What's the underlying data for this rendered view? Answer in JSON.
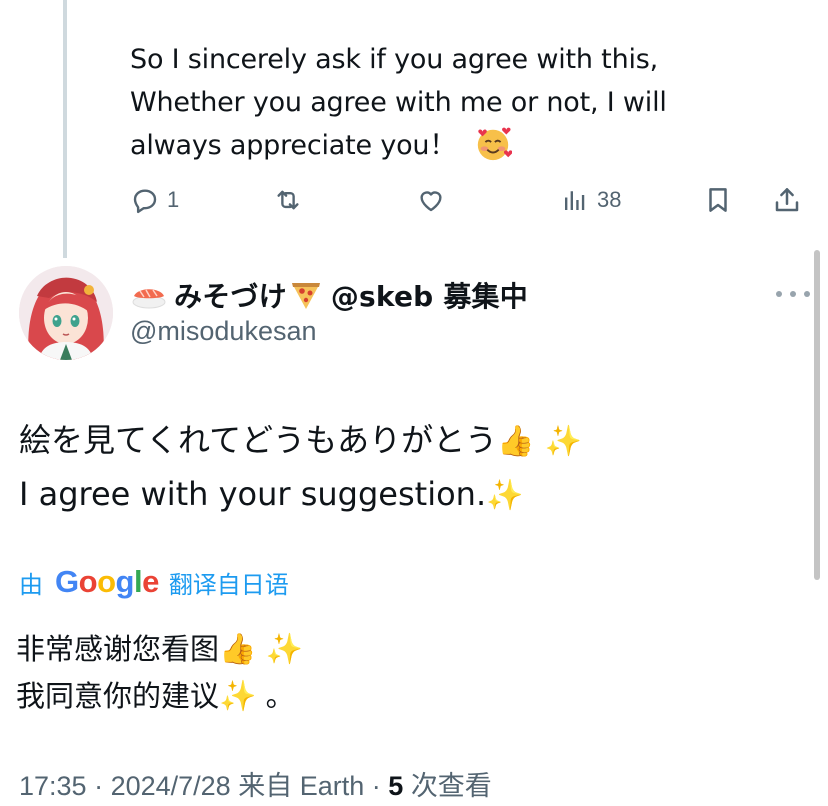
{
  "parent_tweet": {
    "lines": [
      "So I sincerely ask if you agree with this,",
      "Whether you agree with me or not, I will",
      "always appreciate you！"
    ],
    "emoji": "smiling-face-with-hearts",
    "actions": {
      "reply_count": "1",
      "retweet_count": "",
      "like_count": "",
      "views_count": "38"
    }
  },
  "reply_tweet": {
    "display_name": "みそづけ",
    "display_name_suffix": "@skeb 募集中",
    "handle": "@misodukesan",
    "lines": [
      "絵を見てくれてどうもありがとう",
      "I agree with your suggestion."
    ],
    "translation": {
      "by_label": "由",
      "provider": "Google",
      "lang_label": "翻译自日语",
      "lines": [
        "非常感谢您看图",
        "我同意你的建议"
      ],
      "period": "。"
    },
    "meta": {
      "time": "17:35",
      "date": "2024/7/28",
      "source": "来自 Earth",
      "views": "5",
      "views_label": "次查看"
    }
  },
  "colors": {
    "text": "#0f1419",
    "muted": "#536471",
    "link": "#1d9bf0",
    "thread_line": "#cfd9de"
  }
}
